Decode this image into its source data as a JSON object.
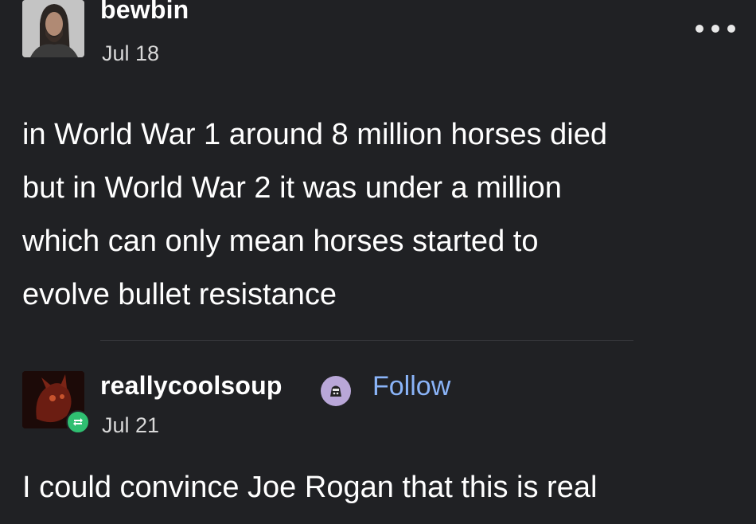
{
  "post": {
    "author": "bewbin",
    "date": "Jul 18",
    "lines": [
      "in World War 1 around 8 million horses died",
      "but in World War 2 it was under a million",
      "which can only mean horses started to",
      "evolve bullet resistance"
    ]
  },
  "reblog": {
    "author": "reallycoolsoup",
    "date": "Jul 21",
    "follow_label": "Follow",
    "text": "I could convince Joe Rogan that this is real"
  },
  "colors": {
    "background": "#202124",
    "text": "#ffffff",
    "link": "#8ab4f8",
    "reblog_badge": "#2fbf71"
  },
  "icons": {
    "more": "more-options-icon",
    "reblog": "reblog-icon",
    "badge": "user-badge-icon"
  }
}
